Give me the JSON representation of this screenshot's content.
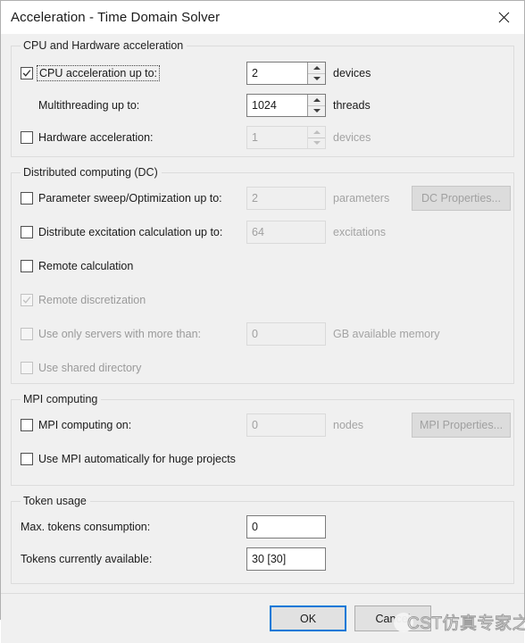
{
  "window": {
    "title": "Acceleration - Time Domain Solver",
    "close_icon": "close-icon"
  },
  "groups": {
    "cpu": {
      "legend": "CPU and Hardware acceleration",
      "cpu_accel": {
        "label": "CPU acceleration up to:",
        "checked": true,
        "value": "2",
        "unit": "devices"
      },
      "multithreading": {
        "label": "Multithreading up to:",
        "value": "1024",
        "unit": "threads"
      },
      "hardware_accel": {
        "label": "Hardware acceleration:",
        "checked": false,
        "value": "1",
        "unit": "devices"
      }
    },
    "dc": {
      "legend": "Distributed computing (DC)",
      "param_sweep": {
        "label": "Parameter sweep/Optimization up to:",
        "checked": false,
        "value": "2",
        "unit": "parameters"
      },
      "dc_properties_button": "DC Properties...",
      "distribute_excitation": {
        "label": "Distribute excitation calculation up to:",
        "checked": false,
        "value": "64",
        "unit": "excitations"
      },
      "remote_calculation": {
        "label": "Remote calculation",
        "checked": false
      },
      "remote_discretization": {
        "label": "Remote discretization",
        "checked": true
      },
      "server_memory": {
        "label": "Use only servers with more than:",
        "checked": false,
        "value": "0",
        "unit": "GB available memory"
      },
      "shared_directory": {
        "label": "Use shared directory",
        "checked": false
      }
    },
    "mpi": {
      "legend": "MPI computing",
      "mpi_on": {
        "label": "MPI computing on:",
        "checked": false,
        "value": "0",
        "unit": "nodes"
      },
      "mpi_properties_button": "MPI Properties...",
      "mpi_auto": {
        "label": "Use MPI automatically for huge projects",
        "checked": false
      }
    },
    "token": {
      "legend": "Token usage",
      "max_consumption": {
        "label": "Max. tokens consumption:",
        "value": "0"
      },
      "available": {
        "label": "Tokens currently available:",
        "value": "30 [30]"
      }
    }
  },
  "footer": {
    "ok": "OK",
    "cancel": "Cancel"
  },
  "watermark": {
    "text": "CST仿真专家之路"
  },
  "colors": {
    "dialog_bg": "#f0f0f0",
    "titlebar_bg": "#ffffff",
    "accent_focus": "#0078d7",
    "group_border": "#dcdcdc",
    "disabled_text": "#a0a0a0"
  }
}
